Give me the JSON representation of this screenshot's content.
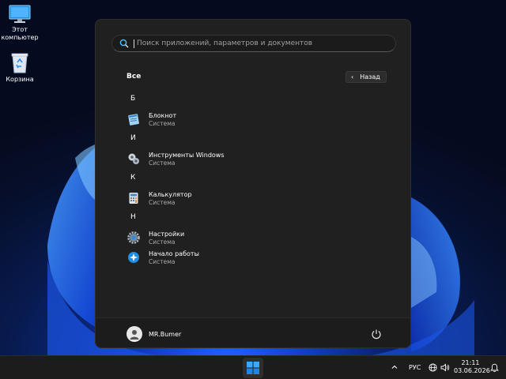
{
  "desktop": {
    "icons": [
      {
        "label": "Этот компьютер",
        "icon": "monitor-icon"
      },
      {
        "label": "Корзина",
        "icon": "recycle-bin-icon"
      }
    ]
  },
  "start_menu": {
    "search": {
      "placeholder": "Поиск приложений, параметров и документов"
    },
    "all_label": "Все",
    "back_label": "Назад",
    "groups": [
      {
        "letter": "Б",
        "apps": [
          {
            "name": "Блокнот",
            "sub": "Система",
            "icon": "notepad-icon"
          }
        ]
      },
      {
        "letter": "И",
        "apps": [
          {
            "name": "Инструменты Windows",
            "sub": "Система",
            "icon": "windows-tools-icon"
          }
        ]
      },
      {
        "letter": "К",
        "apps": [
          {
            "name": "Калькулятор",
            "sub": "Система",
            "icon": "calculator-icon"
          }
        ]
      },
      {
        "letter": "Н",
        "apps": [
          {
            "name": "Настройки",
            "sub": "Система",
            "icon": "settings-gear-icon"
          },
          {
            "name": "Начало работы",
            "sub": "Система",
            "icon": "get-started-icon"
          }
        ]
      }
    ],
    "user": {
      "name": "MR.Bumer"
    }
  },
  "taskbar": {
    "language": "РУС",
    "time": "21:11",
    "date": "03.06.2026"
  },
  "colors": {
    "accent": "#0078d4",
    "menu_bg": "#202020",
    "taskbar_bg": "#1c1c1c"
  }
}
